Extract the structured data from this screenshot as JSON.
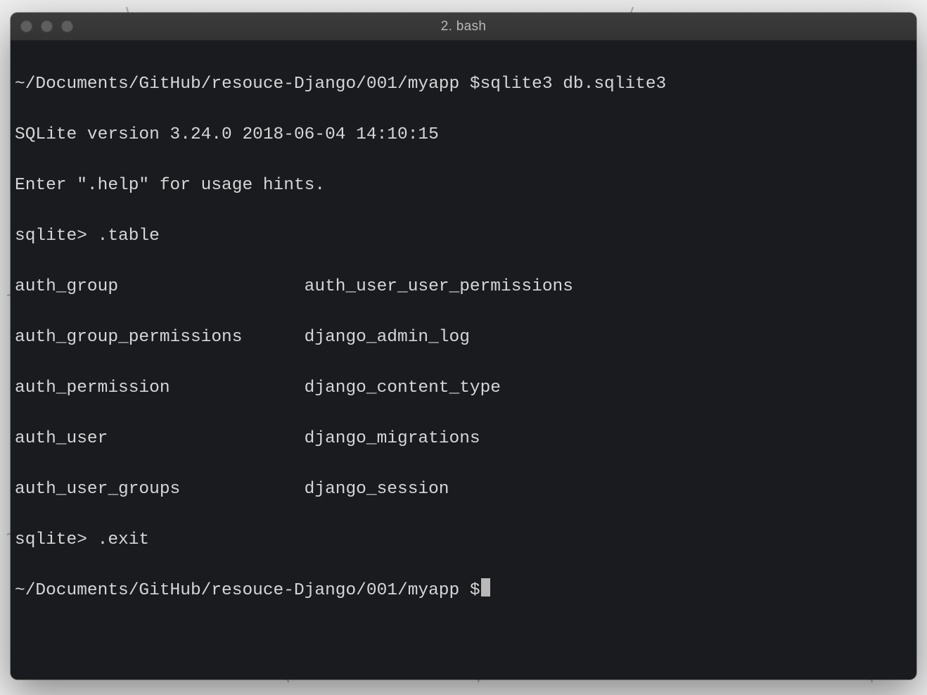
{
  "window": {
    "title": "2. bash"
  },
  "terminal": {
    "prompt_path": "~/Documents/GitHub/resouce-Django/001/myapp",
    "prompt_symbol": "$",
    "lines": {
      "l0_cmd1": "~/Documents/GitHub/resouce-Django/001/myapp $sqlite3 db.sqlite3",
      "l1_version": "SQLite version 3.24.0 2018-06-04 14:10:15",
      "l2_help": "Enter \".help\" for usage hints.",
      "l3_table_cmd": "sqlite> .table",
      "l4": "auth_group                  auth_user_user_permissions",
      "l5": "auth_group_permissions      django_admin_log          ",
      "l6": "auth_permission             django_content_type       ",
      "l7": "auth_user                   django_migrations         ",
      "l8": "auth_user_groups            django_session            ",
      "l9_exit": "sqlite> .exit",
      "l10_prompt": "~/Documents/GitHub/resouce-Django/001/myapp $"
    },
    "tables_col1": [
      "auth_group",
      "auth_group_permissions",
      "auth_permission",
      "auth_user",
      "auth_user_groups"
    ],
    "tables_col2": [
      "auth_user_user_permissions",
      "django_admin_log",
      "django_content_type",
      "django_migrations",
      "django_session"
    ],
    "sqlite_commands": [
      ".table",
      ".exit"
    ],
    "shell_command": "sqlite3 db.sqlite3",
    "sqlite_version": "3.24.0",
    "sqlite_build_date": "2018-06-04 14:10:15"
  }
}
